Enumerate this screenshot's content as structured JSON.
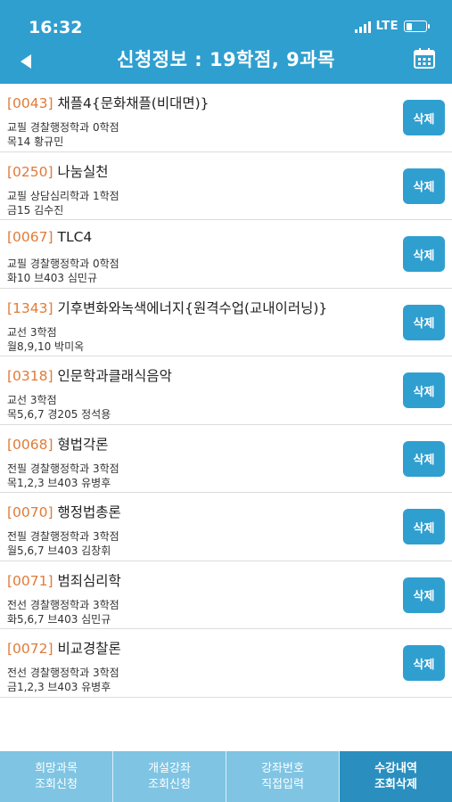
{
  "status": {
    "time": "16:32",
    "network": "LTE"
  },
  "header": {
    "title": "신청정보 : 19학점,  9과목"
  },
  "courses": [
    {
      "code": "[0043]",
      "name": "채플4{문화채플(비대면)}",
      "line1": "교필 경찰행정학과 0학점",
      "line2": "목14  황규민",
      "delete_label": "삭제"
    },
    {
      "code": "[0250]",
      "name": "나눔실천",
      "line1": "교필 상담심리학과 1학점",
      "line2": "금15  김수진",
      "delete_label": "삭제"
    },
    {
      "code": "[0067]",
      "name": "TLC4",
      "line1": "교필 경찰행정학과 0학점",
      "line2": "화10 브403 심민규",
      "delete_label": "삭제"
    },
    {
      "code": "[1343]",
      "name": "기후변화와녹색에너지{원격수업(교내이러닝)}",
      "line1": "교선  3학점",
      "line2": "월8,9,10  박미옥",
      "delete_label": "삭제"
    },
    {
      "code": "[0318]",
      "name": "인문학과클래식음악",
      "line1": "교선  3학점",
      "line2": "목5,6,7 경205 정석용",
      "delete_label": "삭제"
    },
    {
      "code": "[0068]",
      "name": "형법각론",
      "line1": "전필 경찰행정학과 3학점",
      "line2": "목1,2,3 브403 유병후",
      "delete_label": "삭제"
    },
    {
      "code": "[0070]",
      "name": "행정법총론",
      "line1": "전필 경찰행정학과 3학점",
      "line2": "월5,6,7 브403 김창휘",
      "delete_label": "삭제"
    },
    {
      "code": "[0071]",
      "name": "범죄심리학",
      "line1": "전선 경찰행정학과 3학점",
      "line2": "화5,6,7 브403 심민규",
      "delete_label": "삭제"
    },
    {
      "code": "[0072]",
      "name": "비교경찰론",
      "line1": "전선 경찰행정학과 3학점",
      "line2": "금1,2,3 브403 유병후",
      "delete_label": "삭제"
    }
  ],
  "tabs": [
    {
      "line1": "희망과목",
      "line2": "조회신청"
    },
    {
      "line1": "개설강좌",
      "line2": "조회신청"
    },
    {
      "line1": "강좌번호",
      "line2": "직접입력"
    },
    {
      "line1": "수강내역",
      "line2": "조회삭제"
    }
  ],
  "colors": {
    "primary": "#2f9fd0",
    "code": "#e07b39",
    "tab": "#7fc4e3",
    "tab_active": "#2a8fbf"
  },
  "icons": {
    "back": "back-arrow-icon",
    "calendar": "calendar-icon"
  }
}
